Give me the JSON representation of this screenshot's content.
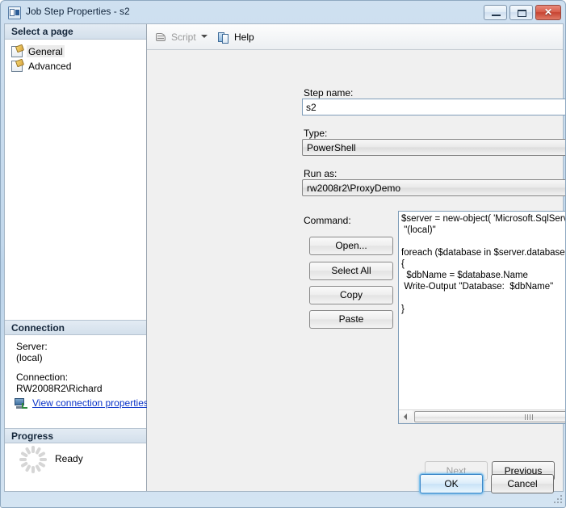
{
  "window": {
    "title": "Job Step Properties - s2",
    "icon": "properties-window-icon",
    "controls": {
      "minimize": "minimize-icon",
      "maximize": "maximize-icon",
      "close": "✕"
    }
  },
  "sidebar": {
    "select_page_header": "Select a page",
    "pages": [
      {
        "label": "General",
        "selected": true
      },
      {
        "label": "Advanced",
        "selected": false
      }
    ],
    "connection": {
      "header": "Connection",
      "server_label": "Server:",
      "server_value": "(local)",
      "connection_label": "Connection:",
      "connection_value": "RW2008R2\\Richard",
      "view_properties_link": "View connection properties",
      "link_color": "#0a33c8",
      "icon": "server-connection-icon"
    },
    "progress": {
      "header": "Progress",
      "status": "Ready",
      "spinner": "progress-spinner-icon"
    }
  },
  "toolbar": {
    "script_label": "Script",
    "script_icon": "script-icon",
    "script_enabled": false,
    "dropdown_icon": "chevron-down-icon",
    "help_label": "Help",
    "help_icon": "help-icon"
  },
  "form": {
    "step_name_label": "Step name:",
    "step_name_value": "s2",
    "step_name_placeholder": "",
    "type_label": "Type:",
    "type_value": "PowerShell",
    "run_as_label": "Run as:",
    "run_as_value": "rw2008r2\\ProxyDemo",
    "command_label": "Command:",
    "command_text": "$server = new-object( 'Microsoft.SqlServer.Management.Smo.Server' )\n \"(local)\"\n\nforeach ($database in $server.databases)\n{\n  $dbName = $database.Name\n Write-Output \"Database:  $dbName\"\n\n}"
  },
  "command_buttons": [
    {
      "label": "Open...",
      "name": "open-button"
    },
    {
      "label": "Select All",
      "name": "select-all-button"
    },
    {
      "label": "Copy",
      "name": "copy-button"
    },
    {
      "label": "Paste",
      "name": "paste-button"
    }
  ],
  "scrollbars": {
    "vertical_up_icon": "scroll-up-arrow-icon",
    "vertical_down_icon": "scroll-down-arrow-icon",
    "horizontal_left_icon": "scroll-left-arrow-icon",
    "horizontal_right_icon": "scroll-right-arrow-icon"
  },
  "navigation": {
    "next_label": "Next",
    "next_enabled": false,
    "previous_label": "Previous",
    "previous_enabled": true
  },
  "footer": {
    "ok_label": "OK",
    "cancel_label": "Cancel",
    "ok_is_default": true,
    "accent_color": "#3c87c8"
  }
}
